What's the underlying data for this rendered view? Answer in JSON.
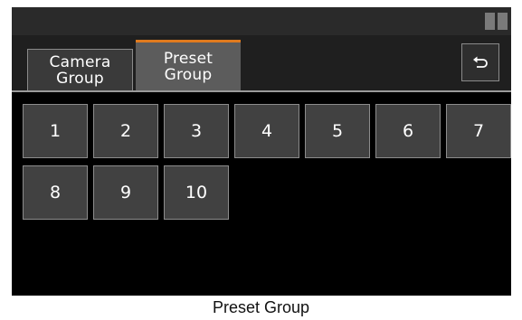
{
  "tabs": [
    {
      "label": "Camera\nGroup",
      "active": false
    },
    {
      "label": "Preset\nGroup",
      "active": true
    }
  ],
  "accent_color": "#e07a1e",
  "back_button_icon": "return-arrow-icon",
  "status_icon": "pause-icon",
  "presets": [
    "1",
    "2",
    "3",
    "4",
    "5",
    "6",
    "7",
    "8",
    "9",
    "10"
  ],
  "caption": "Preset Group"
}
